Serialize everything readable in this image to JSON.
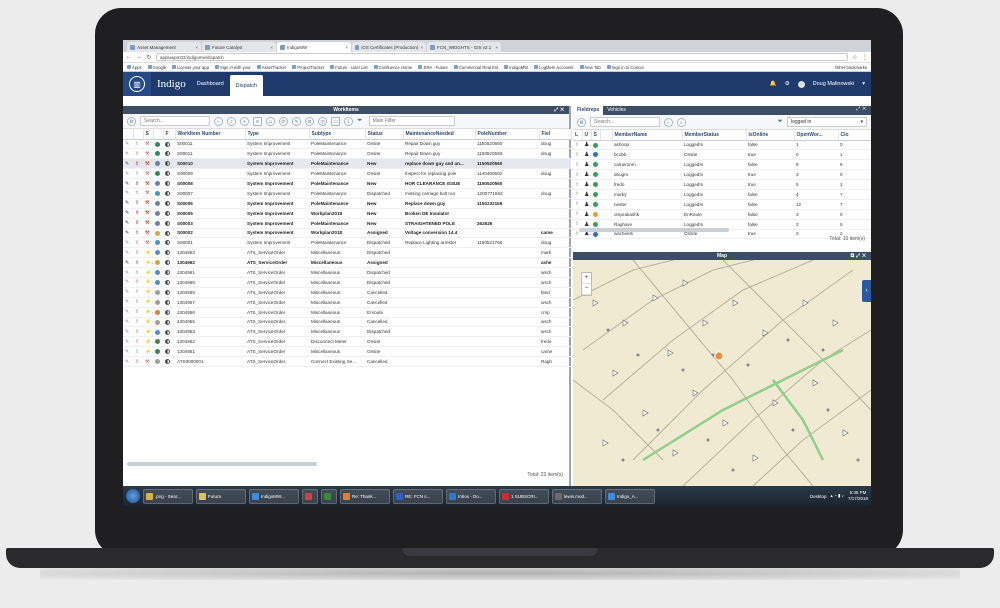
{
  "browser": {
    "tabs": [
      {
        "label": "Asset Management",
        "active": false
      },
      {
        "label": "Future Catalyst",
        "active": false
      },
      {
        "label": "IndigoMW",
        "active": true
      },
      {
        "label": "iOS Certificates (Production)",
        "active": false
      },
      {
        "label": "FCN_WEIGHTS - GIS v2.1",
        "active": false
      }
    ],
    "url": "appluwpm02/indigomw/dispatch",
    "bookmarks": [
      "Apps",
      "Google",
      "License your app",
      "Sign in with your",
      "AssetTracker",
      "ProjectTracker",
      "Future - User List",
      "Confluence Home",
      "JIRA - Future",
      "Commercial Real Est",
      "IndigoMW",
      "LogMeIn Accounts",
      "New Tab",
      "Sign in to Concur"
    ],
    "other_bookmarks": "Other bookmarks"
  },
  "app": {
    "brand": "Indigo",
    "nav": [
      {
        "label": "Dashboard",
        "active": false
      },
      {
        "label": "Dispatch",
        "active": true
      }
    ],
    "user": "Doug Malinowski"
  },
  "workitems": {
    "title": "WorkItems",
    "search_placeholder": "Search...",
    "filter_placeholder": "Main Filter",
    "columns": [
      "",
      "",
      "S",
      "",
      "F",
      "WorkItem Number",
      "Type",
      "Subtype",
      "Status",
      "MaintenanceNeeded",
      "PoleNumber",
      "Fiel"
    ],
    "rows": [
      {
        "num": "S00011",
        "type": "System Improvement",
        "sub": "PoleMaintenance",
        "status": "Onsite",
        "maint": "Repair Down guy",
        "pole": "1150520550",
        "fiel": "doug",
        "bold": false,
        "bolt": false
      },
      {
        "num": "S00011",
        "type": "System Improvement",
        "sub": "PoleMaintenance",
        "status": "Onsite",
        "maint": "Repair Down guy",
        "pole": "1150520560",
        "fiel": "doug",
        "bold": false,
        "bolt": false
      },
      {
        "num": "S00010",
        "type": "System Improvement",
        "sub": "PoleMaintenance",
        "status": "New",
        "maint": "replace down guy and an...",
        "pole": "1150520560",
        "fiel": "",
        "bold": true,
        "bolt": false,
        "selected": true
      },
      {
        "num": "S00009",
        "type": "System Improvement",
        "sub": "PoleMaintenance",
        "status": "Onsite",
        "maint": "Inspect for replacing pole",
        "pole": "1140400602",
        "fiel": "doug",
        "bold": false,
        "bolt": false
      },
      {
        "num": "S00008",
        "type": "System Improvement",
        "sub": "PoleMaintenance",
        "status": "New",
        "maint": "HOR CLEARANCE ISSUE",
        "pole": "1150520560",
        "fiel": "",
        "bold": true,
        "bolt": false
      },
      {
        "num": "S00007",
        "type": "System Improvement",
        "sub": "PoleMaintenance",
        "status": "Dispatched",
        "maint": "missing carriage bolt nut",
        "pole": "1200771663",
        "fiel": "doug",
        "bold": false,
        "bolt": false
      },
      {
        "num": "S00006",
        "type": "System Improvement",
        "sub": "PoleMaintenance",
        "status": "New",
        "maint": "Replace down guy",
        "pole": "1150232156",
        "fiel": "",
        "bold": true,
        "bolt": false
      },
      {
        "num": "S00005",
        "type": "System Improvement",
        "sub": "Workplan2018",
        "status": "New",
        "maint": "Broken DE Insulator",
        "pole": "",
        "fiel": "",
        "bold": true,
        "bolt": false
      },
      {
        "num": "S00003",
        "type": "System Improvement",
        "sub": "PoleMaintenance",
        "status": "New",
        "maint": "STRAIGHTENED POLE",
        "pole": "262626",
        "fiel": "",
        "bold": true,
        "bolt": false
      },
      {
        "num": "S00002",
        "type": "System Improvement",
        "sub": "Workplan2018",
        "status": "Assigned",
        "maint": "Voltage conversion 14.4",
        "pole": "",
        "fiel": "came",
        "bold": true,
        "bolt": false
      },
      {
        "num": "S00001",
        "type": "System Improvement",
        "sub": "PoleMaintenance",
        "status": "Dispatched",
        "maint": "Replace Lighting arrester",
        "pole": "1150521766",
        "fiel": "doug",
        "bold": false,
        "bolt": false
      },
      {
        "num": "1304963",
        "type": "ATS_ServiceOrder",
        "sub": "Miscellaneous",
        "status": "Dispatched",
        "maint": "",
        "pole": "",
        "fiel": "mark",
        "bold": false,
        "bolt": true
      },
      {
        "num": "1304962",
        "type": "ATS_ServiceOrder",
        "sub": "Miscellaneous",
        "status": "Assigned",
        "maint": "",
        "pole": "",
        "fiel": "ashe",
        "bold": true,
        "bolt": true
      },
      {
        "num": "1304961",
        "type": "ATS_ServiceOrder",
        "sub": "Miscellaneous",
        "status": "Dispatched",
        "maint": "",
        "pole": "",
        "fiel": "wsch",
        "bold": false,
        "bolt": true
      },
      {
        "num": "1304960",
        "type": "ATS_ServiceOrder",
        "sub": "Miscellaneous",
        "status": "Dispatched",
        "maint": "",
        "pole": "",
        "fiel": "wsch",
        "bold": false,
        "bolt": true
      },
      {
        "num": "1304959",
        "type": "ATS_ServiceOrder",
        "sub": "Miscellaneous",
        "status": "Cancelled",
        "maint": "",
        "pole": "",
        "fiel": "bled",
        "bold": false,
        "bolt": true
      },
      {
        "num": "1304957",
        "type": "ATS_ServiceOrder",
        "sub": "Miscellaneous",
        "status": "Cancelled",
        "maint": "",
        "pole": "",
        "fiel": "wsch",
        "bold": false,
        "bolt": true
      },
      {
        "num": "1304956",
        "type": "ATS_ServiceOrder",
        "sub": "Miscellaneous",
        "status": "Enroute",
        "maint": "",
        "pole": "",
        "fiel": "cmp",
        "bold": false,
        "bolt": true
      },
      {
        "num": "1304955",
        "type": "ATS_ServiceOrder",
        "sub": "Miscellaneous",
        "status": "Cancelled",
        "maint": "",
        "pole": "",
        "fiel": "wsch",
        "bold": false,
        "bolt": true
      },
      {
        "num": "1304953",
        "type": "ATS_ServiceOrder",
        "sub": "Miscellaneous",
        "status": "Dispatched",
        "maint": "",
        "pole": "",
        "fiel": "wsch",
        "bold": false,
        "bolt": true
      },
      {
        "num": "1304952",
        "type": "ATS_ServiceOrder",
        "sub": "Disconnect Meter",
        "status": "Onsite",
        "maint": "",
        "pole": "",
        "fiel": "fredo",
        "bold": false,
        "bolt": true
      },
      {
        "num": "1304951",
        "type": "ATS_ServiceOrder",
        "sub": "Miscellaneous",
        "status": "Onsite",
        "maint": "",
        "pole": "",
        "fiel": "came",
        "bold": false,
        "bolt": true
      },
      {
        "num": "ATS0000001",
        "type": "ATS_ServiceOrder",
        "sub": "Connect Existing Se...",
        "status": "Cancelled",
        "maint": "",
        "pole": "",
        "fiel": "Ragh",
        "bold": false,
        "bolt": false
      }
    ],
    "total": "Total: 23 item(s)"
  },
  "fieldreps": {
    "tabs": [
      {
        "label": "Fieldreps",
        "active": true
      },
      {
        "label": "Vehicles",
        "active": false
      }
    ],
    "search_placeholder": "Search...",
    "dropdown_value": "logged in",
    "columns": [
      "L",
      "U",
      "S",
      "",
      "MemberName",
      "MemberStatus",
      "IsOnline",
      "OpenWor...",
      "Clo"
    ],
    "rows": [
      {
        "name": "ashoop",
        "status": "LoggedIn",
        "online": "false",
        "open": "1",
        "clo": "0"
      },
      {
        "name": "bcobb",
        "status": "Onsite",
        "online": "true",
        "open": "0",
        "clo": "1"
      },
      {
        "name": "cameronm",
        "status": "LoggedIn",
        "online": "false",
        "open": "8",
        "clo": "6"
      },
      {
        "name": "dougm",
        "status": "LoggedIn",
        "online": "true",
        "open": "3",
        "clo": "0"
      },
      {
        "name": "fredo",
        "status": "LoggedIn",
        "online": "true",
        "open": "5",
        "clo": "1"
      },
      {
        "name": "marky",
        "status": "LoggedIn",
        "online": "false",
        "open": "4",
        "clo": "7"
      },
      {
        "name": "nester",
        "status": "LoggedIn",
        "online": "false",
        "open": "12",
        "clo": "7"
      },
      {
        "name": "omprakashk",
        "status": "EnRoute",
        "online": "false",
        "open": "3",
        "clo": "0"
      },
      {
        "name": "Raghavv",
        "status": "LoggedIn",
        "online": "false",
        "open": "3",
        "clo": "5"
      },
      {
        "name": "wscheels",
        "status": "Onsite",
        "online": "true",
        "open": "3",
        "clo": "2"
      }
    ],
    "total": "Total: 10 item(s)"
  },
  "map": {
    "title": "Map",
    "zoom_in": "+",
    "zoom_out": "−"
  },
  "taskbar": {
    "items": [
      ".png - Sear...",
      "Futura",
      "IndigoMW...",
      "",
      "",
      "Re: Thank...",
      "RE: FCN s...",
      "Inbox - Do...",
      "1 SUBSCRI...",
      "lewis.mod...",
      "Indigo_A..."
    ],
    "desktop": "Desktop",
    "time": "5:35 PM",
    "date": "7/17/2018"
  }
}
